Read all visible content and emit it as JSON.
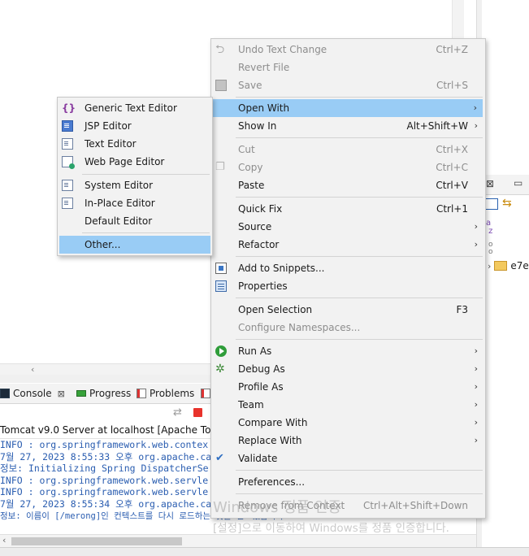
{
  "console": {
    "tabs": [
      {
        "label": "Console"
      },
      {
        "label": "Progress"
      },
      {
        "label": "Problems"
      }
    ],
    "server_line": "Tomcat v9.0 Server at localhost [Apache Tomcat",
    "lines": [
      "INFO : org.springframework.web.contex",
      "7월 27, 2023 8:55:33 오후 org.apache.cat",
      "정보: Initializing Spring DispatcherSe",
      "INFO : org.springframework.web.servle",
      "INFO : org.springframework.web.servle",
      "7월 27, 2023 8:55:34 오후 org.apache.cat",
      "정보: 이름이 [/merong]인 컨텍스트를 다시 로드하는 것을 완료했습니다"
    ]
  },
  "right_panel": {
    "tree_item": "e7e"
  },
  "context_menu": {
    "items": [
      {
        "label": "Undo Text Change",
        "shortcut": "Ctrl+Z",
        "disabled": true
      },
      {
        "label": "Revert File",
        "shortcut": "",
        "disabled": true
      },
      {
        "label": "Save",
        "shortcut": "Ctrl+S",
        "disabled": true
      },
      {
        "label": "Open With",
        "shortcut": "",
        "submenu": true,
        "selected": true
      },
      {
        "label": "Show In",
        "shortcut": "Alt+Shift+W",
        "submenu": true
      },
      {
        "label": "Cut",
        "shortcut": "Ctrl+X",
        "disabled": true
      },
      {
        "label": "Copy",
        "shortcut": "Ctrl+C",
        "disabled": true
      },
      {
        "label": "Paste",
        "shortcut": "Ctrl+V"
      },
      {
        "label": "Quick Fix",
        "shortcut": "Ctrl+1"
      },
      {
        "label": "Source",
        "shortcut": "",
        "submenu": true
      },
      {
        "label": "Refactor",
        "shortcut": "",
        "submenu": true
      },
      {
        "label": "Add to Snippets...",
        "shortcut": ""
      },
      {
        "label": "Properties",
        "shortcut": ""
      },
      {
        "label": "Open Selection",
        "shortcut": "F3"
      },
      {
        "label": "Configure Namespaces...",
        "shortcut": "",
        "disabled": true
      },
      {
        "label": "Run As",
        "shortcut": "",
        "submenu": true
      },
      {
        "label": "Debug As",
        "shortcut": "",
        "submenu": true
      },
      {
        "label": "Profile As",
        "shortcut": "",
        "submenu": true
      },
      {
        "label": "Team",
        "shortcut": "",
        "submenu": true
      },
      {
        "label": "Compare With",
        "shortcut": "",
        "submenu": true
      },
      {
        "label": "Replace With",
        "shortcut": "",
        "submenu": true
      },
      {
        "label": "Validate",
        "shortcut": ""
      },
      {
        "label": "Preferences...",
        "shortcut": ""
      },
      {
        "label": "Remove from Context",
        "shortcut": "Ctrl+Alt+Shift+Down",
        "disabled": true
      }
    ]
  },
  "open_with_submenu": {
    "items": [
      {
        "label": "Generic Text Editor"
      },
      {
        "label": "JSP Editor"
      },
      {
        "label": "Text Editor"
      },
      {
        "label": "Web Page Editor"
      },
      {
        "label": "System Editor"
      },
      {
        "label": "In-Place Editor"
      },
      {
        "label": "Default Editor"
      },
      {
        "label": "Other...",
        "selected": true
      }
    ]
  },
  "watermark": {
    "line1": "Windows 정품 인증",
    "line2": "[설정]으로 이동하여 Windows를 정품 인증합니다."
  },
  "icons": {
    "arrow": "›",
    "close": "⊠",
    "undo": "⮌"
  }
}
